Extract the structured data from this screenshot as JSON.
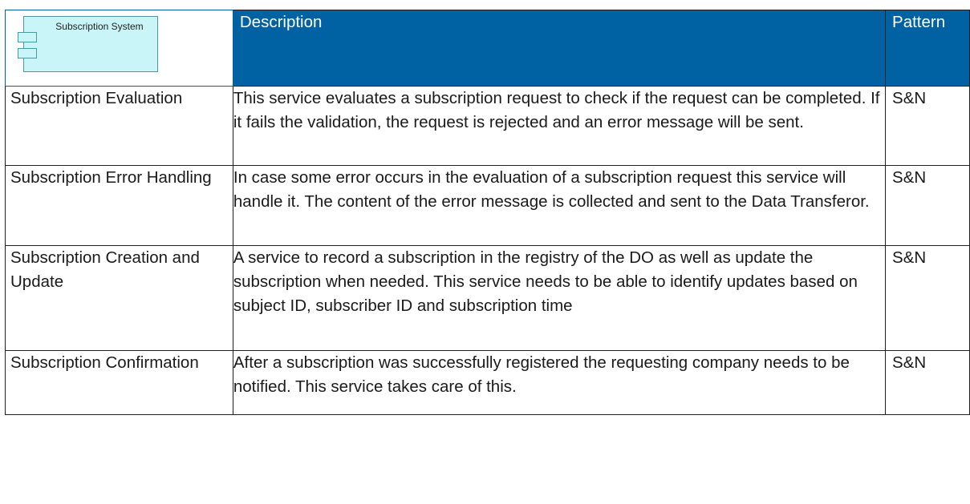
{
  "header": {
    "component_label": "Subscription System",
    "col_description": "Description",
    "col_pattern": "Pattern"
  },
  "rows": [
    {
      "name": "Subscription Evaluation",
      "description": "This service evaluates a subscription request to check if the request can be completed. If it fails the validation, the request is rejected and an error message will be sent.",
      "pattern": "S&N"
    },
    {
      "name": "Subscription Error Handling",
      "description": "In case some error occurs in the evaluation of a subscription request this service will handle it. The content of the error message is collected and sent to the Data Transferor.",
      "pattern": "S&N"
    },
    {
      "name": "Subscription Creation and Update",
      "description": "A service to record a subscription in the registry of the DO as well as update the subscription when needed. This service needs to be able to identify updates based on subject ID, subscriber ID and subscription time",
      "pattern": "S&N"
    },
    {
      "name": "Subscription Confirmation",
      "description": "After a subscription was successfully registered the requesting company needs to be notified. This service takes care of this.",
      "pattern": "S&N"
    }
  ]
}
